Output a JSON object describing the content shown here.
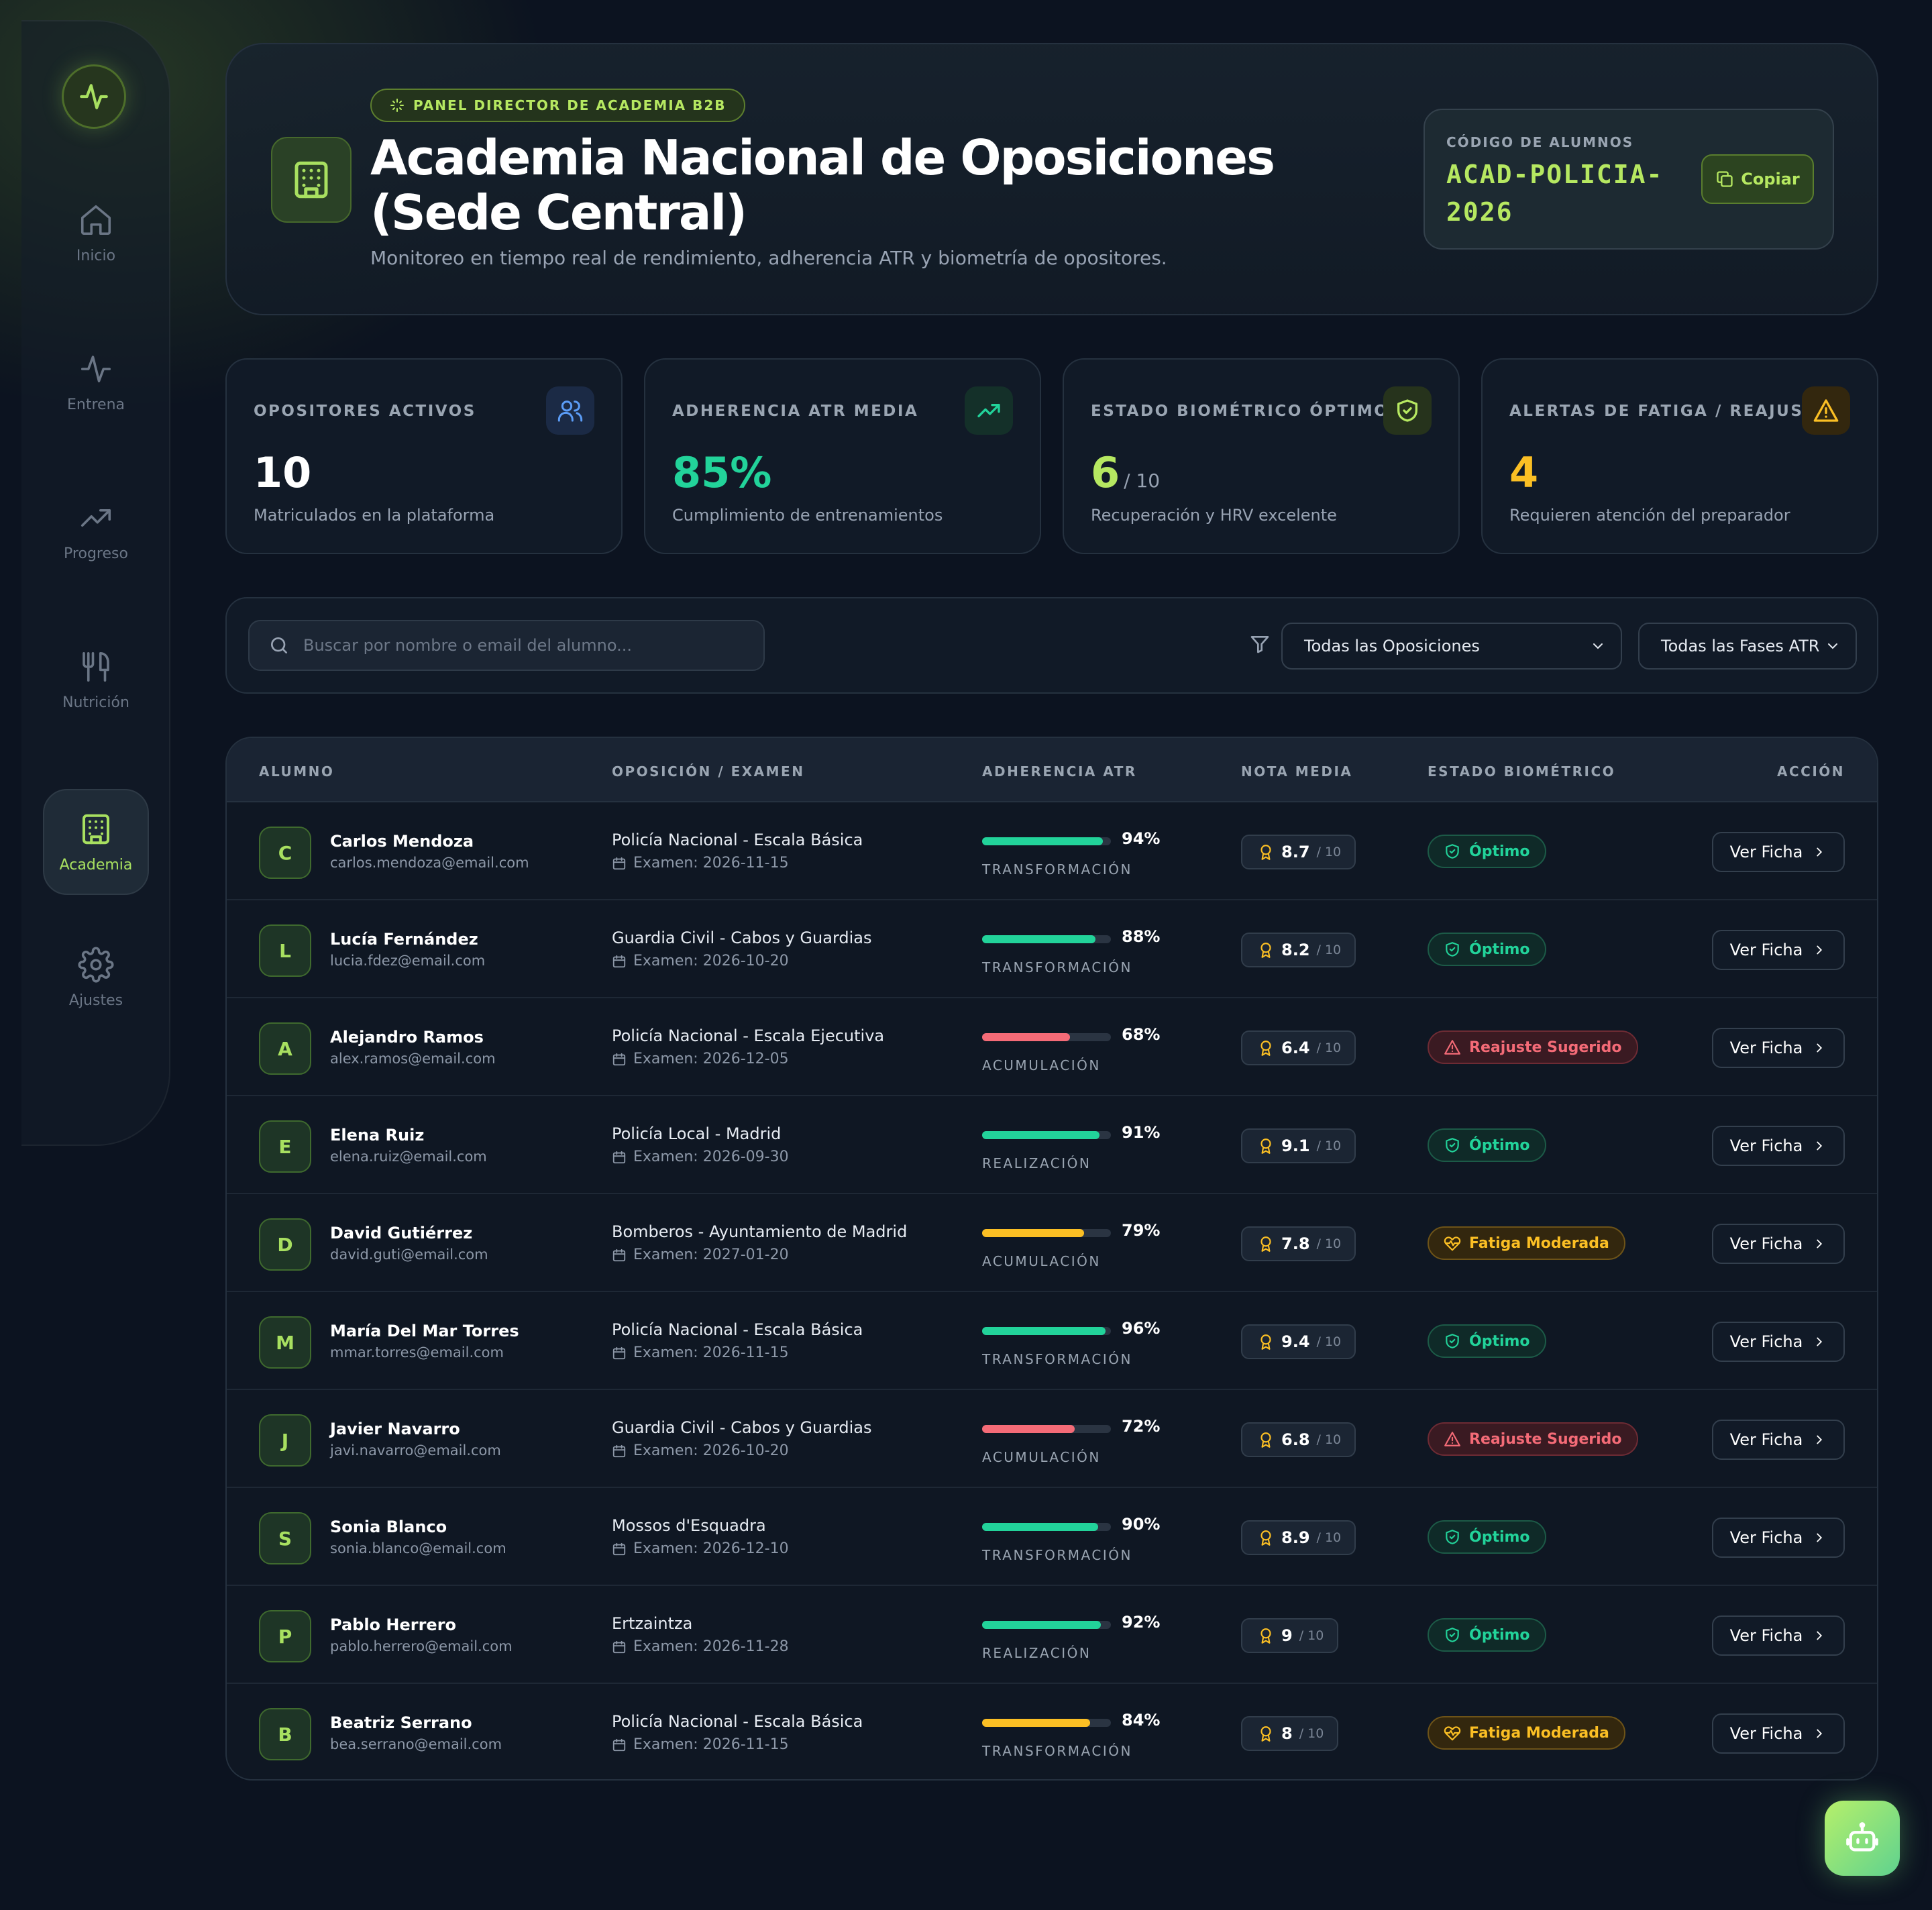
{
  "sidebar": {
    "items": [
      {
        "label": "Inicio",
        "icon": "home-icon"
      },
      {
        "label": "Entrena",
        "icon": "activity-icon"
      },
      {
        "label": "Progreso",
        "icon": "trending-up-icon"
      },
      {
        "label": "Nutrición",
        "icon": "utensils-icon"
      },
      {
        "label": "Academia",
        "icon": "building-icon",
        "active": true
      },
      {
        "label": "Ajustes",
        "icon": "gear-icon"
      }
    ]
  },
  "header": {
    "badge": "PANEL DIRECTOR DE ACADEMIA B2B",
    "title": "Academia Nacional de Oposiciones (Sede Central)",
    "subtitle": "Monitoreo en tiempo real de rendimiento, adherencia ATR y biometría de opositores.",
    "code_label": "CÓDIGO DE ALUMNOS",
    "code_value": "ACAD-POLICIA-2026",
    "copy_label": "Copiar"
  },
  "stats": [
    {
      "label": "OPOSITORES ACTIVOS",
      "value": "10",
      "of": "",
      "desc": "Matriculados en la plataforma",
      "color": "#ffffff",
      "icon": "users-icon"
    },
    {
      "label": "ADHERENCIA ATR MEDIA",
      "value": "85%",
      "of": "",
      "desc": "Cumplimiento de entrenamientos",
      "color": "#22d39a",
      "icon": "trending-up-icon"
    },
    {
      "label": "ESTADO BIOMÉTRICO ÓPTIMO",
      "value": "6",
      "of": "/ 10",
      "desc": "Recuperación y HRV excelente",
      "color": "#b6e861",
      "icon": "shield-check-icon"
    },
    {
      "label": "ALERTAS DE FATIGA / REAJUSTE",
      "value": "4",
      "of": "",
      "desc": "Requieren atención del preparador",
      "color": "#fbbf24",
      "icon": "warning-icon"
    }
  ],
  "filters": {
    "search_placeholder": "Buscar por nombre o email del alumno...",
    "opos_select": "Todas las Oposiciones",
    "phase_select": "Todas las Fases ATR"
  },
  "table": {
    "headers": [
      "ALUMNO",
      "OPOSICIÓN / EXAMEN",
      "ADHERENCIA ATR",
      "NOTA MEDIA",
      "ESTADO BIOMÉTRICO",
      "ACCIÓN"
    ],
    "action_label": "Ver Ficha",
    "grade_den": "/ 10",
    "rows": [
      {
        "initial": "C",
        "name": "Carlos Mendoza",
        "email": "carlos.mendoza@email.com",
        "opo": "Policía Nacional - Escala Básica",
        "exam": "Examen: 2026-11-15",
        "adh": 94,
        "adh_label": "94%",
        "phase": "TRANSFORMACIÓN",
        "bar_color": "#22d39a",
        "grade": "8.7",
        "bio": "Óptimo",
        "bio_type": "ok"
      },
      {
        "initial": "L",
        "name": "Lucía Fernández",
        "email": "lucia.fdez@email.com",
        "opo": "Guardia Civil - Cabos y Guardias",
        "exam": "Examen: 2026-10-20",
        "adh": 88,
        "adh_label": "88%",
        "phase": "TRANSFORMACIÓN",
        "bar_color": "#22d39a",
        "grade": "8.2",
        "bio": "Óptimo",
        "bio_type": "ok"
      },
      {
        "initial": "A",
        "name": "Alejandro Ramos",
        "email": "alex.ramos@email.com",
        "opo": "Policía Nacional - Escala Ejecutiva",
        "exam": "Examen: 2026-12-05",
        "adh": 68,
        "adh_label": "68%",
        "phase": "ACUMULACIÓN",
        "bar_color": "#f46b77",
        "grade": "6.4",
        "bio": "Reajuste Sugerido",
        "bio_type": "warn"
      },
      {
        "initial": "E",
        "name": "Elena Ruiz",
        "email": "elena.ruiz@email.com",
        "opo": "Policía Local - Madrid",
        "exam": "Examen: 2026-09-30",
        "adh": 91,
        "adh_label": "91%",
        "phase": "REALIZACIÓN",
        "bar_color": "#22d39a",
        "grade": "9.1",
        "bio": "Óptimo",
        "bio_type": "ok"
      },
      {
        "initial": "D",
        "name": "David Gutiérrez",
        "email": "david.guti@email.com",
        "opo": "Bomberos - Ayuntamiento de Madrid",
        "exam": "Examen: 2027-01-20",
        "adh": 79,
        "adh_label": "79%",
        "phase": "ACUMULACIÓN",
        "bar_color": "#fbbf24",
        "grade": "7.8",
        "bio": "Fatiga Moderada",
        "bio_type": "fat"
      },
      {
        "initial": "M",
        "name": "María Del Mar Torres",
        "email": "mmar.torres@email.com",
        "opo": "Policía Nacional - Escala Básica",
        "exam": "Examen: 2026-11-15",
        "adh": 96,
        "adh_label": "96%",
        "phase": "TRANSFORMACIÓN",
        "bar_color": "#22d39a",
        "grade": "9.4",
        "bio": "Óptimo",
        "bio_type": "ok"
      },
      {
        "initial": "J",
        "name": "Javier Navarro",
        "email": "javi.navarro@email.com",
        "opo": "Guardia Civil - Cabos y Guardias",
        "exam": "Examen: 2026-10-20",
        "adh": 72,
        "adh_label": "72%",
        "phase": "ACUMULACIÓN",
        "bar_color": "#f46b77",
        "grade": "6.8",
        "bio": "Reajuste Sugerido",
        "bio_type": "warn"
      },
      {
        "initial": "S",
        "name": "Sonia Blanco",
        "email": "sonia.blanco@email.com",
        "opo": "Mossos d'Esquadra",
        "exam": "Examen: 2026-12-10",
        "adh": 90,
        "adh_label": "90%",
        "phase": "TRANSFORMACIÓN",
        "bar_color": "#22d39a",
        "grade": "8.9",
        "bio": "Óptimo",
        "bio_type": "ok"
      },
      {
        "initial": "P",
        "name": "Pablo Herrero",
        "email": "pablo.herrero@email.com",
        "opo": "Ertzaintza",
        "exam": "Examen: 2026-11-28",
        "adh": 92,
        "adh_label": "92%",
        "phase": "REALIZACIÓN",
        "bar_color": "#22d39a",
        "grade": "9",
        "bio": "Óptimo",
        "bio_type": "ok"
      },
      {
        "initial": "B",
        "name": "Beatriz Serrano",
        "email": "bea.serrano@email.com",
        "opo": "Policía Nacional - Escala Básica",
        "exam": "Examen: 2026-11-15",
        "adh": 84,
        "adh_label": "84%",
        "phase": "TRANSFORMACIÓN",
        "bar_color": "#fbbf24",
        "grade": "8",
        "bio": "Fatiga Moderada",
        "bio_type": "fat"
      }
    ]
  },
  "fab_icon": "bot-icon"
}
